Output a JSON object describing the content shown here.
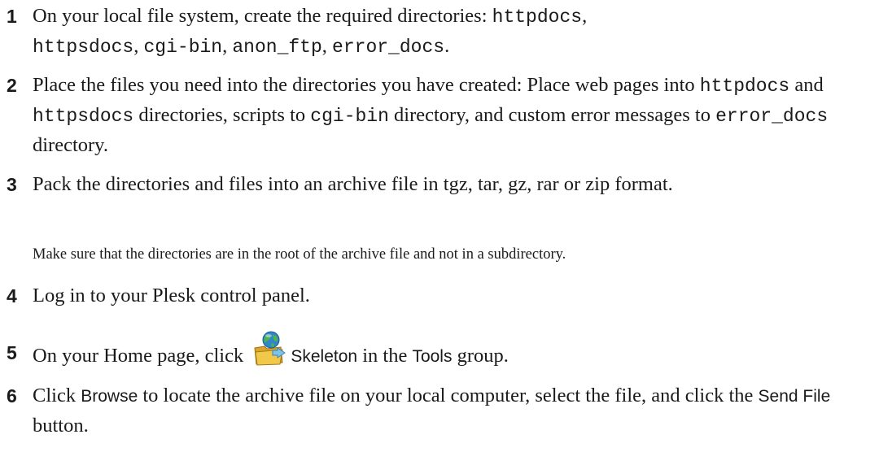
{
  "steps": [
    {
      "number": "1",
      "parts": [
        "On your local file system, create the required directories: ",
        "httpdocs",
        ", ",
        "httpsdocs",
        ", ",
        "cgi-bin",
        ", ",
        "anon_ftp",
        ", ",
        "error_docs",
        "."
      ]
    },
    {
      "number": "2",
      "parts": [
        "Place the files you need into the directories you have created: Place web pages into ",
        "httpdocs",
        " and ",
        "httpsdocs",
        " directories, scripts to ",
        "cgi-bin",
        " directory, and custom error messages to ",
        "error_docs",
        " directory."
      ]
    },
    {
      "number": "3",
      "parts": [
        "Pack the directories and files into an archive file in tgz, tar, gz, rar or zip format."
      ],
      "note": "Make sure that the directories are in the root of the archive file and not in a subdirectory."
    },
    {
      "number": "4",
      "parts": [
        "Log in to your Plesk control panel."
      ]
    },
    {
      "number": "5",
      "parts": [
        "On your Home page, click ",
        "Skeleton",
        " in the ",
        "Tools",
        " group."
      ],
      "icon": "skeleton-icon"
    },
    {
      "number": "6",
      "parts": [
        "Click ",
        "Browse",
        " to locate the archive file on your local computer, select the file, and click the ",
        "Send File",
        " button."
      ]
    }
  ]
}
